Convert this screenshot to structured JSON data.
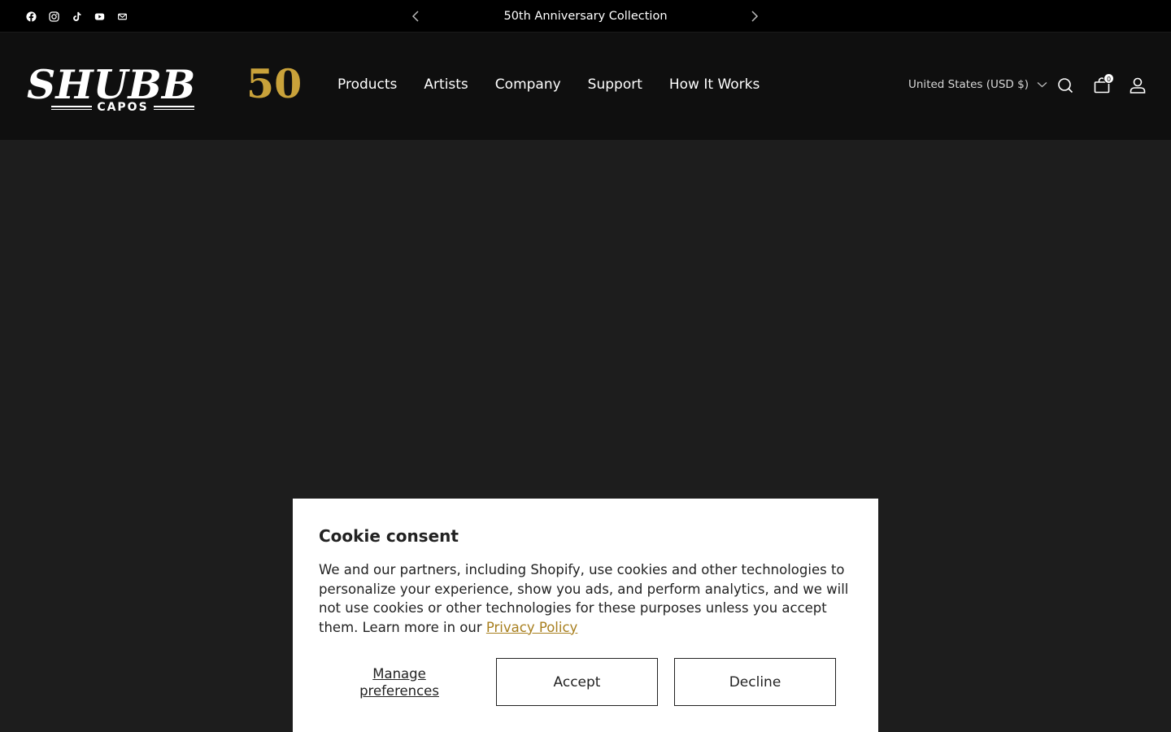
{
  "announcement": {
    "text": "50th Anniversary Collection",
    "social_icons": [
      "facebook-icon",
      "instagram-icon",
      "tiktok-icon",
      "youtube-icon",
      "email-icon"
    ]
  },
  "header": {
    "logo": {
      "word": "SHUBB",
      "number": "50",
      "sub": "CAPOS"
    },
    "nav": [
      "Products",
      "Artists",
      "Company",
      "Support",
      "How It Works"
    ],
    "country_selector": "United States (USD $)",
    "cart_count": "0"
  },
  "cookie": {
    "title": "Cookie consent",
    "body": "We and our partners, including Shopify, use cookies and other technologies to personalize your experience, show you ads, and perform analytics, and we will not use cookies or other technologies for these purposes unless you accept them. Learn more in our ",
    "link": "Privacy Policy",
    "manage_line1": "Manage",
    "manage_line2": "preferences",
    "accept": "Accept",
    "decline": "Decline"
  },
  "colors": {
    "gold": "#c9a23a",
    "link": "#a87f1e",
    "background": "#1d1d1d",
    "header": "#0f0f0f"
  }
}
